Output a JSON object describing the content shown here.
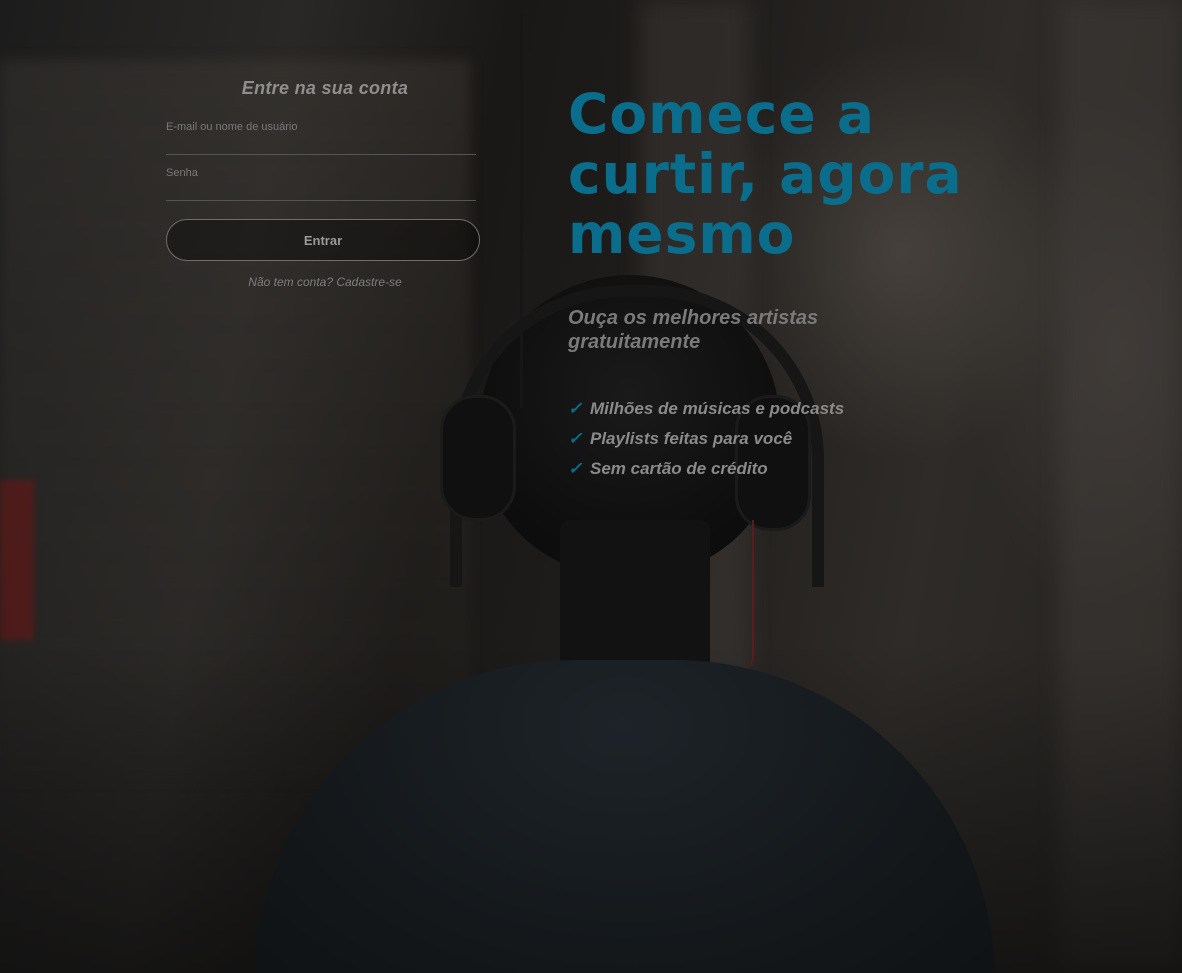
{
  "login": {
    "title": "Entre na sua conta",
    "email_label": "E-mail ou nome de usuário",
    "email_placeholder": "",
    "email_hint": "",
    "password_label": "Senha",
    "password_placeholder": "",
    "submit_label": "Entrar",
    "signup_text": "Não tem conta? Cadastre-se"
  },
  "hero": {
    "title": "Comece a curtir, agora mesmo",
    "subtitle": "Ouça os melhores artistas gratuitamente",
    "benefits": [
      {
        "icon": "check-icon",
        "label": "Milhões de músicas e podcasts"
      },
      {
        "icon": "check-icon",
        "label": "Playlists feitas para você"
      },
      {
        "icon": "check-icon",
        "label": "Sem cartão de crédito"
      }
    ]
  },
  "colors": {
    "accent": "#0b6d8c",
    "overlay": "#0b0b0b",
    "text_muted": "#8a8a8a"
  },
  "icons": {
    "check": "✓"
  }
}
